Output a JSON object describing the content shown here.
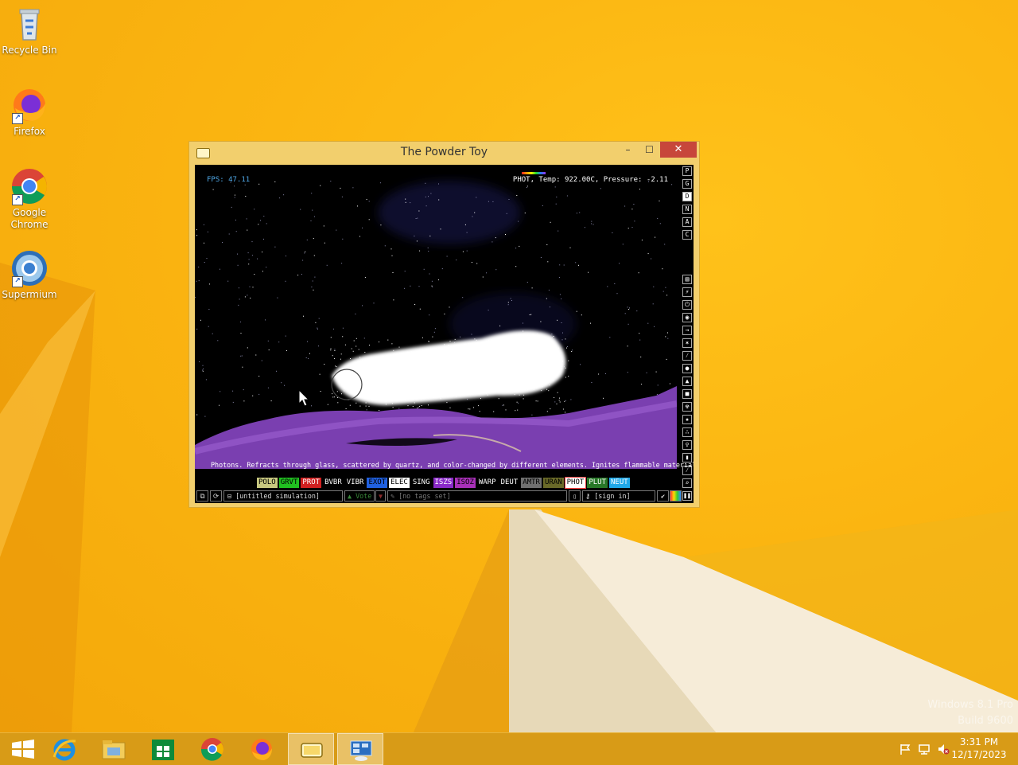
{
  "desktop": {
    "icons": [
      {
        "label": "Recycle Bin",
        "icon": "recycle-bin-icon"
      },
      {
        "label": "Firefox",
        "icon": "firefox-icon"
      },
      {
        "label": "Google Chrome",
        "icon": "chrome-icon"
      },
      {
        "label": "Supermium",
        "icon": "supermium-icon"
      }
    ],
    "watermark": {
      "line1": "Windows 8.1 Pro",
      "line2": "Build 9600"
    }
  },
  "window": {
    "title": "The Powder Toy",
    "minimize": "–",
    "maximize": "☐",
    "close": "✕"
  },
  "game": {
    "fps": "FPS: 47.11",
    "hud_info": "PHOT, Temp: 922.00C, Pressure: -2.11",
    "right_buttons_top": [
      "P",
      "G",
      "D",
      "N",
      "A",
      "C"
    ],
    "active_top_button": "D",
    "description": "Photons. Refracts through glass, scattered by quartz, and color-changed by different elements. Ignites flammable materials.",
    "elements": [
      {
        "name": "POLO",
        "bg": "#c8c880",
        "fg": "#000000"
      },
      {
        "name": "GRVT",
        "bg": "#20c020",
        "fg": "#000000"
      },
      {
        "name": "PROT",
        "bg": "#d02020",
        "fg": "#ffffff"
      },
      {
        "name": "BVBR",
        "bg": "#000000",
        "fg": "#ffffff"
      },
      {
        "name": "VIBR",
        "bg": "#000000",
        "fg": "#ffffff"
      },
      {
        "name": "EXOT",
        "bg": "#2060e0",
        "fg": "#000000"
      },
      {
        "name": "ELEC",
        "bg": "#ffffff",
        "fg": "#000000"
      },
      {
        "name": "SING",
        "bg": "#000000",
        "fg": "#ffffff"
      },
      {
        "name": "ISZS",
        "bg": "#8a2ac8",
        "fg": "#ffffff"
      },
      {
        "name": "ISOZ",
        "bg": "#a830b8",
        "fg": "#000000"
      },
      {
        "name": "WARP",
        "bg": "#000000",
        "fg": "#ffffff"
      },
      {
        "name": "DEUT",
        "bg": "#000000",
        "fg": "#ffffff"
      },
      {
        "name": "AMTR",
        "bg": "#707070",
        "fg": "#000000"
      },
      {
        "name": "URAN",
        "bg": "#6a6a28",
        "fg": "#000000"
      },
      {
        "name": "PHOT",
        "bg": "#ffffff",
        "fg": "#000000",
        "selected": true
      },
      {
        "name": "PLUT",
        "bg": "#287828",
        "fg": "#ffffff"
      },
      {
        "name": "NEUT",
        "bg": "#20a8e8",
        "fg": "#ffffff"
      }
    ],
    "bottom": {
      "save_name": "[untitled simulation]",
      "vote": "Vote",
      "tags": "[no tags set]",
      "signin": "[sign in]"
    }
  },
  "taskbar": {
    "apps": [
      "start-icon",
      "ie-icon",
      "file-explorer-icon",
      "store-icon",
      "chrome-icon",
      "firefox-icon",
      "powder-toy-icon",
      "control-panel-icon"
    ],
    "time": "3:31 PM",
    "date": "12/17/2023"
  },
  "colors": {
    "desktop_bg": "#f5b400",
    "window_frame": "#f2cf6d",
    "close_red": "#c7463b",
    "taskbar": "#d89b17"
  }
}
